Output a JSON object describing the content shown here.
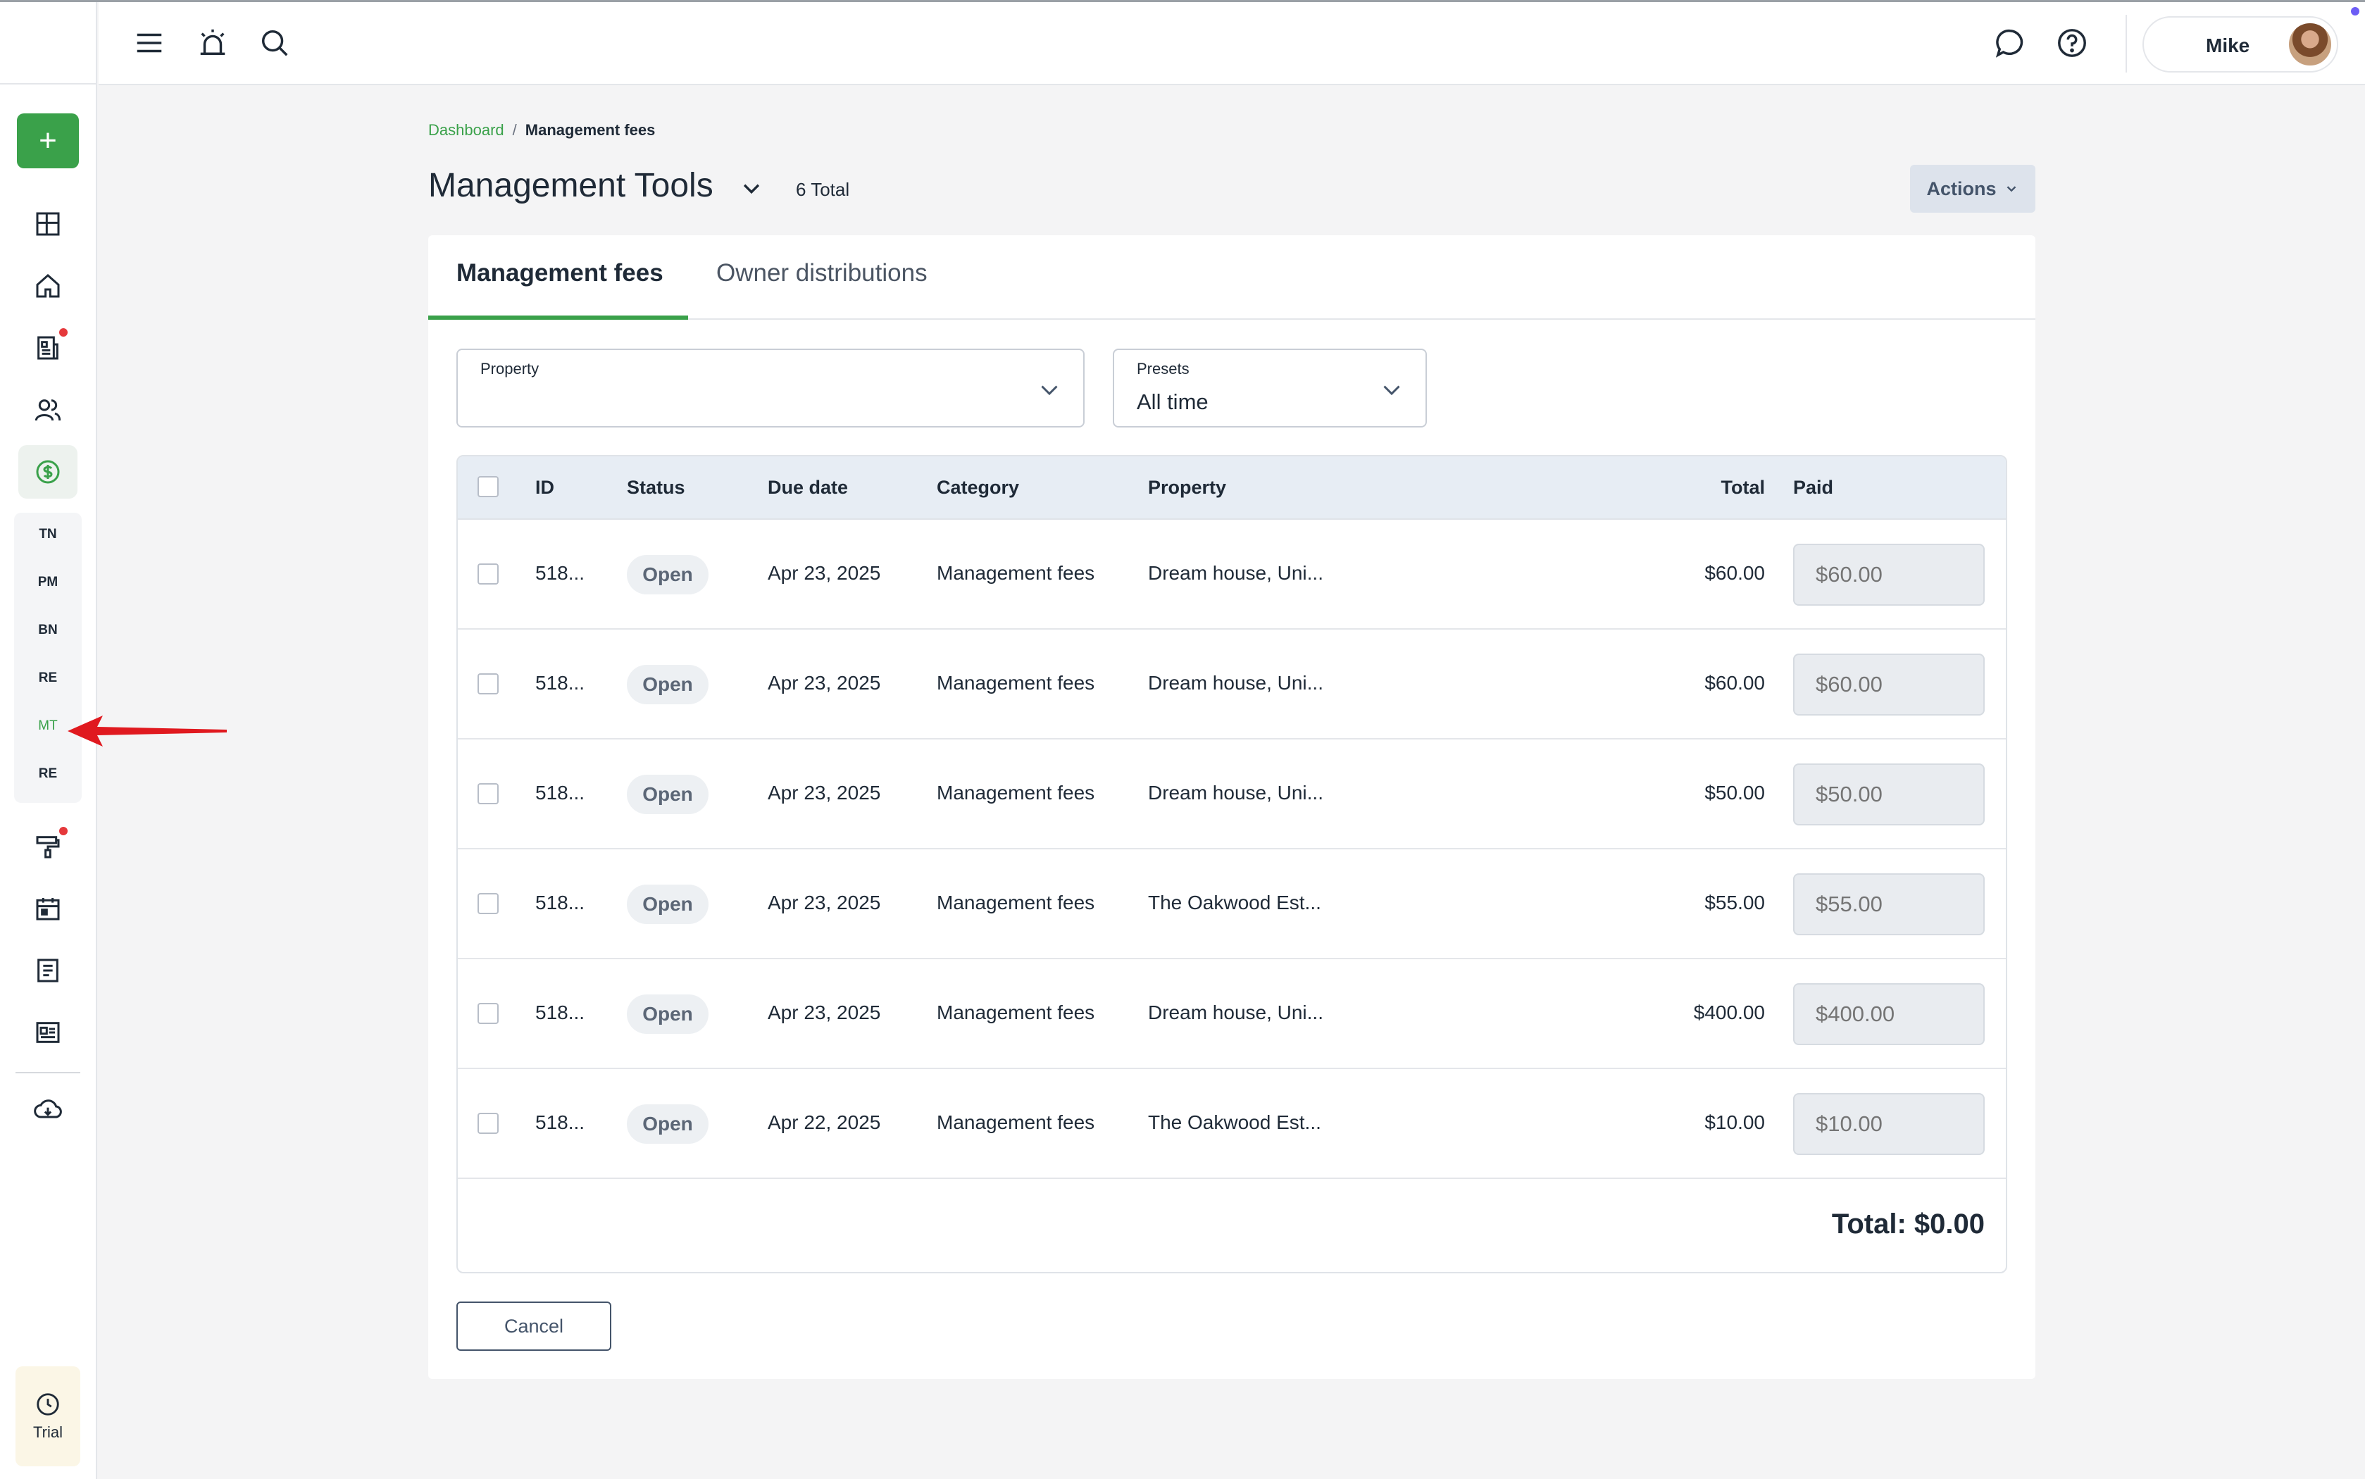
{
  "header": {
    "user_name": "Mike"
  },
  "sidebar": {
    "add_label": "+",
    "submenu": [
      "TN",
      "PM",
      "BN",
      "RE",
      "MT",
      "RE"
    ],
    "active_submenu": "MT",
    "trial_label": "Trial"
  },
  "breadcrumb": {
    "root": "Dashboard",
    "separator": "/",
    "current": "Management fees"
  },
  "page": {
    "title": "Management Tools",
    "total": "6 Total",
    "actions_label": "Actions"
  },
  "tabs": [
    {
      "label": "Management fees",
      "active": true
    },
    {
      "label": "Owner distributions",
      "active": false
    }
  ],
  "filters": {
    "property": {
      "label": "Property",
      "value": ""
    },
    "presets": {
      "label": "Presets",
      "value": "All time"
    }
  },
  "table": {
    "columns": {
      "id": "ID",
      "status": "Status",
      "due_date": "Due date",
      "category": "Category",
      "property": "Property",
      "total": "Total",
      "paid": "Paid"
    },
    "rows": [
      {
        "id": "518...",
        "status": "Open",
        "due_date": "Apr 23, 2025",
        "category": "Management fees",
        "property": "Dream house, Uni...",
        "total": "$60.00",
        "paid": "$60.00"
      },
      {
        "id": "518...",
        "status": "Open",
        "due_date": "Apr 23, 2025",
        "category": "Management fees",
        "property": "Dream house, Uni...",
        "total": "$60.00",
        "paid": "$60.00"
      },
      {
        "id": "518...",
        "status": "Open",
        "due_date": "Apr 23, 2025",
        "category": "Management fees",
        "property": "Dream house, Uni...",
        "total": "$50.00",
        "paid": "$50.00"
      },
      {
        "id": "518...",
        "status": "Open",
        "due_date": "Apr 23, 2025",
        "category": "Management fees",
        "property": "The Oakwood Est...",
        "total": "$55.00",
        "paid": "$55.00"
      },
      {
        "id": "518...",
        "status": "Open",
        "due_date": "Apr 23, 2025",
        "category": "Management fees",
        "property": "Dream house, Uni...",
        "total": "$400.00",
        "paid": "$400.00"
      },
      {
        "id": "518...",
        "status": "Open",
        "due_date": "Apr 22, 2025",
        "category": "Management fees",
        "property": "The Oakwood Est...",
        "total": "$10.00",
        "paid": "$10.00"
      }
    ],
    "grand_total": "Total: $0.00"
  },
  "buttons": {
    "cancel": "Cancel"
  },
  "colors": {
    "accent": "#3aa14a",
    "notification": "#e5383b",
    "annotation_arrow": "#e0191f"
  }
}
